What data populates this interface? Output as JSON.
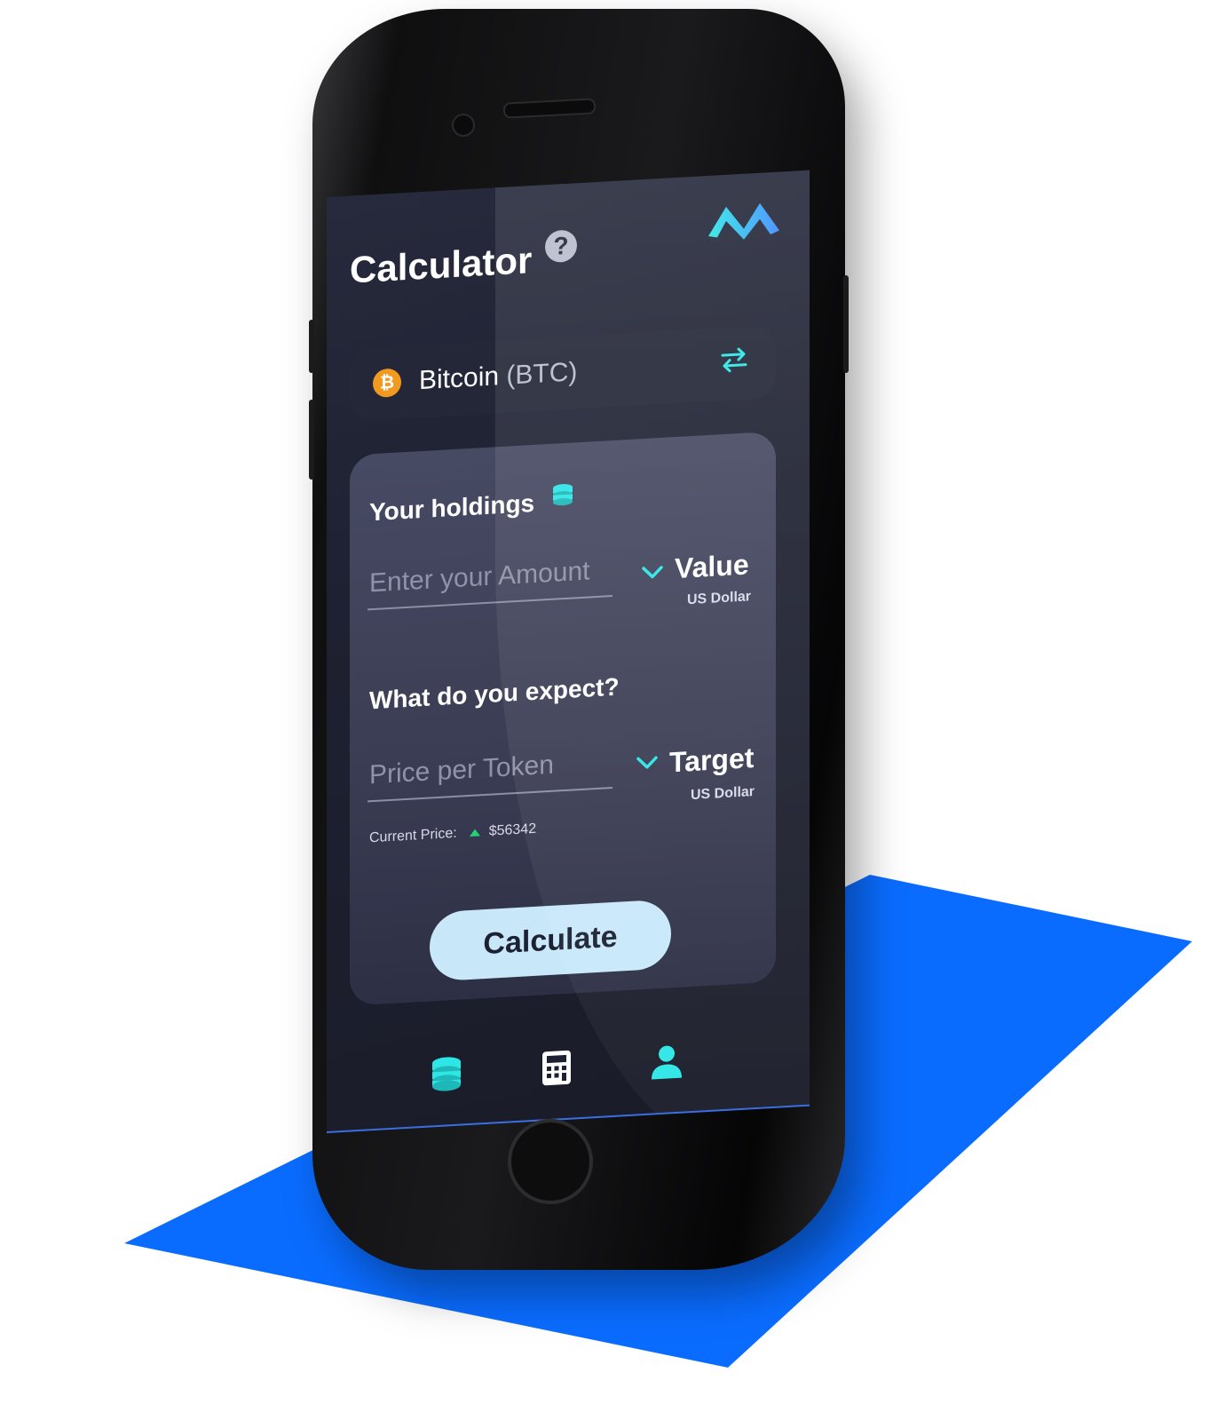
{
  "colors": {
    "accent": "#2ee6e6",
    "floor": "#0a6cff",
    "bitcoin": "#f29a1f",
    "price_up": "#25d07a",
    "button_bg": "#c8e8fa"
  },
  "header": {
    "title": "Calculator",
    "help_glyph": "?"
  },
  "coin_selector": {
    "icon_glyph": "₿",
    "name": "Bitcoin",
    "ticker": "(BTC)"
  },
  "holdings": {
    "label": "Your holdings",
    "amount_placeholder": "Enter your Amount",
    "amount_value": "",
    "unit_title": "Value",
    "unit_sub": "US Dollar"
  },
  "expectation": {
    "label": "What do you expect?",
    "price_placeholder": "Price per Token",
    "price_value": "",
    "unit_title": "Target",
    "unit_sub": "US Dollar",
    "current_price_label": "Current Price:",
    "current_price_value": "$56342"
  },
  "actions": {
    "calculate_label": "Calculate"
  },
  "bottom_nav": {
    "items": [
      {
        "icon": "coins-stack-icon",
        "active": true
      },
      {
        "icon": "calculator-icon",
        "active": false
      },
      {
        "icon": "user-icon",
        "active": true
      }
    ]
  }
}
